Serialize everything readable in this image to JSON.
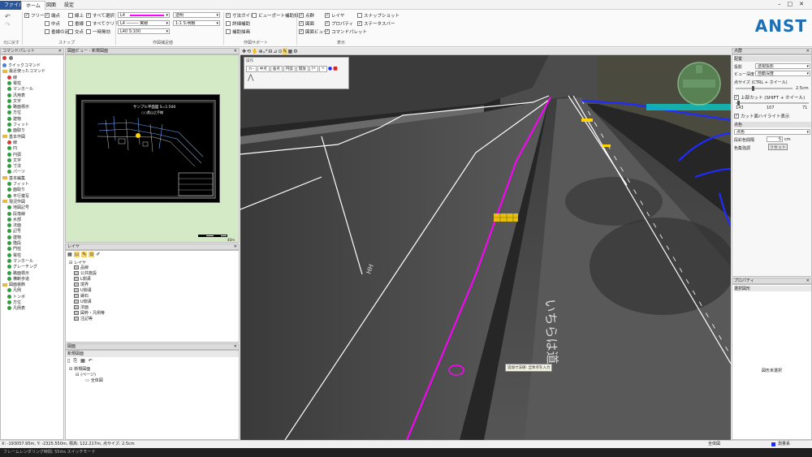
{
  "menu": {
    "file": "ファイル",
    "tabs": [
      "ホーム",
      "図面",
      "設定"
    ]
  },
  "ribbon": {
    "undo_label": "元に戻す",
    "snap": {
      "label": "スナップ",
      "items": [
        "フリー",
        "端点",
        "線上",
        "すべて選択",
        "中点",
        "垂線",
        "すべてクリア",
        "垂線の足",
        "交点",
        "一時無効"
      ]
    },
    "drawing": {
      "label": "作図補足値",
      "line_style": "L4",
      "line_style2": "L4",
      "line_type": "実線",
      "scale_text": "L40 S:100",
      "opacity_label": "透明",
      "scale_label": "1:1",
      "detail_label": "S:明朝"
    },
    "support": {
      "label": "作図サポート",
      "items": [
        "寸法ガイド",
        "ビューポート補助描画",
        "詳細補助",
        "補助描画"
      ]
    },
    "display": {
      "label": "表示",
      "items": [
        "点群",
        "図面",
        "図面ビュー",
        "レイヤ",
        "プロパティ",
        "コマンドパレット",
        "スナップショット",
        "ステータスバー"
      ]
    }
  },
  "logo": "ANST",
  "command_palette": {
    "title": "コマンドパレット",
    "items": [
      {
        "label": "クイックコマンド",
        "type": "icon"
      },
      {
        "label": "最近使ったコマンド",
        "type": "folder"
      },
      {
        "label": "線",
        "type": "red"
      },
      {
        "label": "電柱",
        "type": "green"
      },
      {
        "label": "マンホール",
        "type": "green"
      },
      {
        "label": "汎用表",
        "type": "green"
      },
      {
        "label": "文字",
        "type": "green"
      },
      {
        "label": "路面標示",
        "type": "green"
      },
      {
        "label": "方位",
        "type": "green"
      },
      {
        "label": "建物",
        "type": "green"
      },
      {
        "label": "フィット",
        "type": "green"
      },
      {
        "label": "面取り",
        "type": "green"
      },
      {
        "label": "基本作図",
        "type": "folder"
      },
      {
        "label": "線",
        "type": "red"
      },
      {
        "label": "円",
        "type": "green"
      },
      {
        "label": "円弧",
        "type": "green"
      },
      {
        "label": "文字",
        "type": "green"
      },
      {
        "label": "寸法",
        "type": "green"
      },
      {
        "label": "パーツ",
        "type": "green"
      },
      {
        "label": "基本編集",
        "type": "folder"
      },
      {
        "label": "フィット",
        "type": "green"
      },
      {
        "label": "面取り",
        "type": "green"
      },
      {
        "label": "平行複写",
        "type": "green"
      },
      {
        "label": "現況作図",
        "type": "folder"
      },
      {
        "label": "地図記号",
        "type": "green"
      },
      {
        "label": "段落線",
        "type": "green"
      },
      {
        "label": "水部",
        "type": "green"
      },
      {
        "label": "法面",
        "type": "green"
      },
      {
        "label": "記号",
        "type": "green"
      },
      {
        "label": "建物",
        "type": "green"
      },
      {
        "label": "階段",
        "type": "green"
      },
      {
        "label": "門柱",
        "type": "green"
      },
      {
        "label": "電柱",
        "type": "green"
      },
      {
        "label": "マンホール",
        "type": "green"
      },
      {
        "label": "グレーチング",
        "type": "green"
      },
      {
        "label": "路面標示",
        "type": "green"
      },
      {
        "label": "横断歩道",
        "type": "green"
      },
      {
        "label": "図面装飾",
        "type": "folder"
      },
      {
        "label": "凡例",
        "type": "green"
      },
      {
        "label": "トンボ",
        "type": "green"
      },
      {
        "label": "方位",
        "type": "green"
      },
      {
        "label": "凡例表",
        "type": "green"
      }
    ]
  },
  "drawing_view": {
    "title": "図面ビュー - 新規図面",
    "sheet_title": "サンプル平面図 S=1:500",
    "sheet_subtitle": "○○県山之手線",
    "scale_label": "40m"
  },
  "layers": {
    "title": "レイヤ",
    "root": "レイヤ",
    "items": [
      "品線",
      "公共施設",
      "L側溝",
      "境界",
      "U側溝",
      "縁石",
      "U側溝",
      "法面",
      "図枠・凡例等",
      "注記等"
    ]
  },
  "drawing_tree": {
    "title": "図面",
    "tab": "新規図面",
    "root": "新規図面",
    "page": "(ページ)",
    "leaf": "全体図"
  },
  "viewport_toolbar": {
    "floating_title": "操作",
    "floating_buttons": [
      "ﾌﾘｰ",
      "中点",
      "垂点",
      "円弧",
      "開放",
      "|<",
      "<"
    ]
  },
  "annotation_tooltip": "追加寸法値: 全体点を入力",
  "road_text": "いちらは道",
  "properties": {
    "title": "点群",
    "section": "配置",
    "projection_label": "投影",
    "projection_value": "透視投影",
    "depth_label": "ビュー深度",
    "depth_value": "自動深度",
    "point_size_label": "点サイズ (CTRL + ホイール)",
    "point_size_value": "2.5cm",
    "upper_cut_label": "上部カット (SHIFT + ホイール)",
    "cut_values": [
      "143",
      "107",
      "71"
    ],
    "highlight_label": "カット面ハイライト表示",
    "color_section": "点色",
    "color_value": "点色",
    "thin_label": "段彩色間隔",
    "thin_value": "5",
    "thin_unit": "cm",
    "gray_label": "色集強調",
    "reset_label": "リセット"
  },
  "property_panel": {
    "title": "プロパティ",
    "sub": "選択図形",
    "empty": "図形未選択"
  },
  "status": {
    "coords": "X: -193057.95m, Y: -2325.550m, 標高: 122.217m, 点サイズ: 2.5cm",
    "right_label": "全体図",
    "right_value": "測量系"
  },
  "taskbar": {
    "text": "フレームレンダリング時間: 55ms  スイッチモード"
  },
  "colors": {
    "magenta_line": "#ff00ff",
    "blue_line": "#1f2bff",
    "cyan": "#00d8d8",
    "yellow": "#ffd400"
  }
}
